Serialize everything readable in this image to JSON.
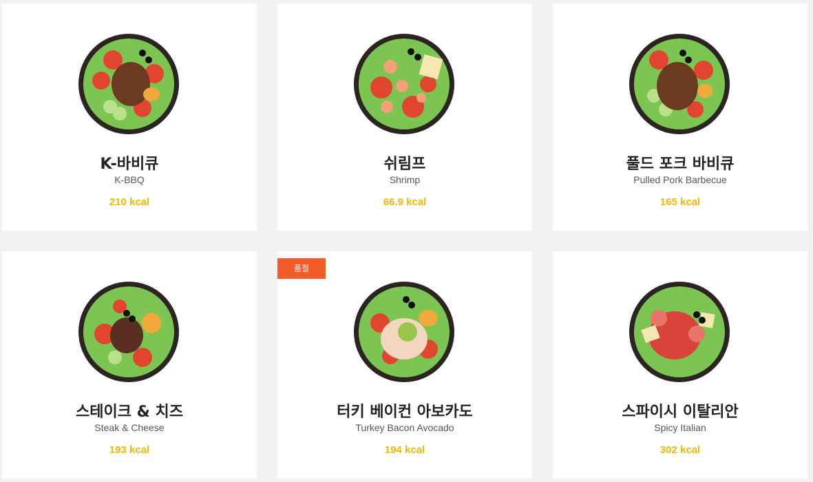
{
  "colors": {
    "background": "#f2f2f2",
    "card": "#ffffff",
    "kcal": "#f2b705",
    "badge": "#f25c2a"
  },
  "products": [
    {
      "name_ko": "K-바비큐",
      "name_en": "K-BBQ",
      "kcal": "210 kcal",
      "badge": "",
      "image": "salad-bowl-kbbq-icon"
    },
    {
      "name_ko": "쉬림프",
      "name_en": "Shrimp",
      "kcal": "66.9 kcal",
      "badge": "",
      "image": "salad-bowl-shrimp-icon"
    },
    {
      "name_ko": "풀드 포크 바비큐",
      "name_en": "Pulled Pork Barbecue",
      "kcal": "165 kcal",
      "badge": "",
      "image": "salad-bowl-pulled-pork-icon"
    },
    {
      "name_ko": "스테이크 & 치즈",
      "name_en": "Steak & Cheese",
      "kcal": "193 kcal",
      "badge": "",
      "image": "salad-bowl-steak-icon"
    },
    {
      "name_ko": "터키 베이컨 아보카도",
      "name_en": "Turkey Bacon Avocado",
      "kcal": "194 kcal",
      "badge": "품절",
      "image": "salad-bowl-turkey-avocado-icon"
    },
    {
      "name_ko": "스파이시 이탈리안",
      "name_en": "Spicy Italian",
      "kcal": "302 kcal",
      "badge": "",
      "image": "salad-bowl-spicy-italian-icon"
    }
  ]
}
